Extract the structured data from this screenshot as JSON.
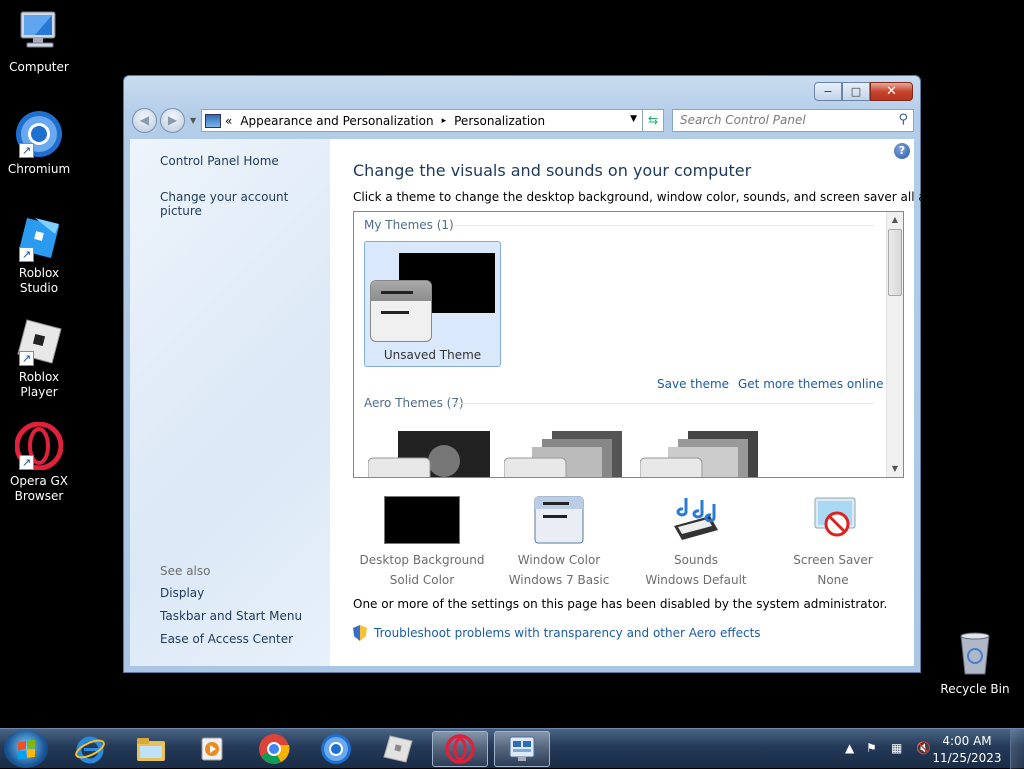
{
  "desktop": {
    "icons": [
      {
        "label": "Computer"
      },
      {
        "label": "Chromium"
      },
      {
        "label": "Roblox Studio"
      },
      {
        "label": "Roblox Player"
      },
      {
        "label": "Opera GX Browser"
      },
      {
        "label": "Recycle Bin"
      }
    ]
  },
  "window": {
    "caption_buttons": {
      "minimize": "−",
      "maximize": "□",
      "close": "✕"
    },
    "address": {
      "overflow": "«",
      "segments": [
        "Appearance and Personalization",
        "Personalization"
      ],
      "separator": "▸"
    },
    "search": {
      "placeholder": "Search Control Panel"
    },
    "left_nav": {
      "links": [
        "Control Panel Home",
        "Change your account picture"
      ],
      "see_also_title": "See also",
      "see_also": [
        "Display",
        "Taskbar and Start Menu",
        "Ease of Access Center"
      ]
    },
    "main": {
      "heading": "Change the visuals and sounds on your computer",
      "subtitle": "Click a theme to change the desktop background, window color, sounds, and screen saver all at once.",
      "my_themes_header": "My Themes (1)",
      "selected_theme": "Unsaved Theme",
      "save_theme": "Save theme",
      "get_more": "Get more themes online",
      "aero_header": "Aero Themes (7)",
      "settings": [
        {
          "name": "Desktop Background",
          "value": "Solid Color"
        },
        {
          "name": "Window Color",
          "value": "Windows 7 Basic"
        },
        {
          "name": "Sounds",
          "value": "Windows Default"
        },
        {
          "name": "Screen Saver",
          "value": "None"
        }
      ],
      "disabled_notice": "One or more of the settings on this page has been disabled by the system administrator.",
      "troubleshoot_link": "Troubleshoot problems with transparency and other Aero effects"
    }
  },
  "taskbar": {
    "clock_time": "4:00 AM",
    "clock_date": "11/25/2023"
  }
}
